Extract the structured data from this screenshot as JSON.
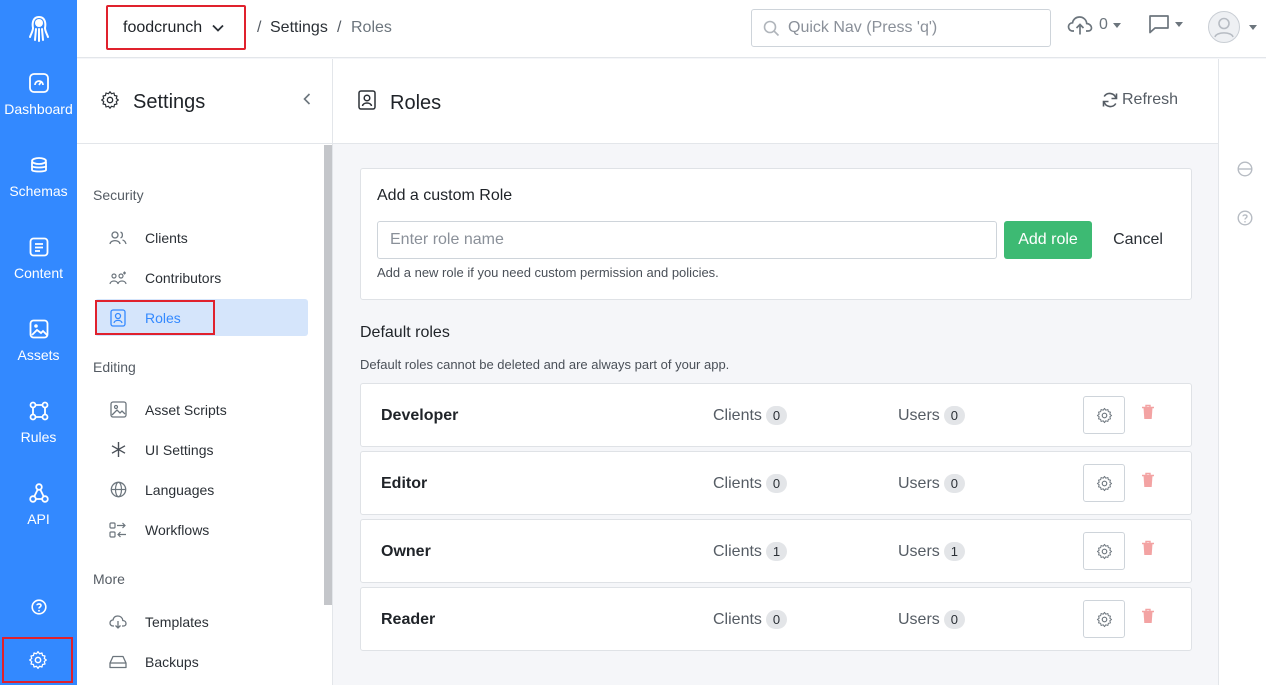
{
  "rail": {
    "items": [
      {
        "label": "Dashboard",
        "icon": "dashboard-icon"
      },
      {
        "label": "Schemas",
        "icon": "schemas-icon"
      },
      {
        "label": "Content",
        "icon": "content-icon"
      },
      {
        "label": "Assets",
        "icon": "assets-icon"
      },
      {
        "label": "Rules",
        "icon": "rules-icon"
      },
      {
        "label": "API",
        "icon": "api-icon"
      }
    ]
  },
  "topbar": {
    "app_name": "foodcrunch",
    "breadcrumb_sep": "/",
    "breadcrumb_1": "Settings",
    "breadcrumb_2": "Roles",
    "search_placeholder": "Quick Nav (Press 'q')",
    "upload_count": "0"
  },
  "settings": {
    "title": "Settings",
    "groups": {
      "security": "Security",
      "editing": "Editing",
      "more": "More"
    },
    "items": {
      "clients": "Clients",
      "contributors": "Contributors",
      "roles": "Roles",
      "asset_scripts": "Asset Scripts",
      "ui_settings": "UI Settings",
      "languages": "Languages",
      "workflows": "Workflows",
      "templates": "Templates",
      "backups": "Backups"
    }
  },
  "main": {
    "title": "Roles",
    "refresh": "Refresh",
    "add": {
      "heading": "Add a custom Role",
      "placeholder": "Enter role name",
      "add_button": "Add role",
      "cancel_button": "Cancel",
      "hint": "Add a new role if you need custom permission and policies."
    },
    "defaults": {
      "title": "Default roles",
      "hint": "Default roles cannot be deleted and are always part of your app."
    },
    "clients_label": "Clients",
    "users_label": "Users",
    "roles": [
      {
        "name": "Developer",
        "clients": "0",
        "users": "0"
      },
      {
        "name": "Editor",
        "clients": "0",
        "users": "0"
      },
      {
        "name": "Owner",
        "clients": "1",
        "users": "1"
      },
      {
        "name": "Reader",
        "clients": "0",
        "users": "0"
      }
    ]
  },
  "colors": {
    "brand": "#3389ff",
    "success": "#3dba73",
    "highlight": "#e0212d"
  }
}
